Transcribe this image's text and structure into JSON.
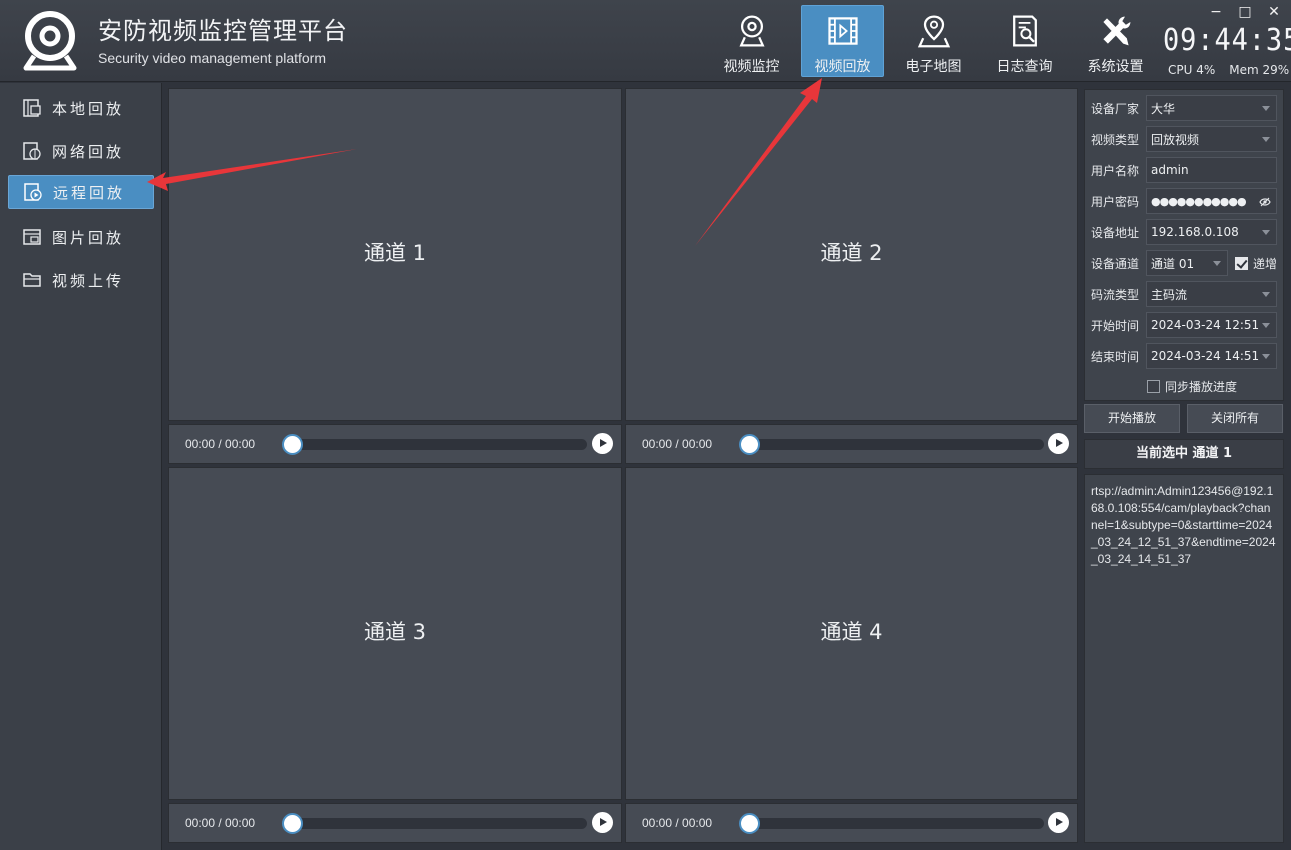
{
  "app": {
    "title": "安防视频监控管理平台",
    "subtitle": "Security video management platform"
  },
  "nav": [
    {
      "label": "视频监控",
      "icon": "webcam-icon"
    },
    {
      "label": "视频回放",
      "icon": "film-icon",
      "active": true
    },
    {
      "label": "电子地图",
      "icon": "map-pin-icon"
    },
    {
      "label": "日志查询",
      "icon": "log-search-icon"
    },
    {
      "label": "系统设置",
      "icon": "tools-icon"
    }
  ],
  "clock": "09:44:35",
  "stats": {
    "cpu": "CPU 4%",
    "mem": "Mem 29%"
  },
  "window_controls": {
    "minimize": "−",
    "maximize": "□",
    "close": "✕"
  },
  "sidebar": [
    {
      "label": "本地回放",
      "icon": "local-playback-icon"
    },
    {
      "label": "网络回放",
      "icon": "network-playback-icon"
    },
    {
      "label": "远程回放",
      "icon": "remote-playback-icon",
      "active": true
    },
    {
      "label": "图片回放",
      "icon": "image-playback-icon"
    },
    {
      "label": "视频上传",
      "icon": "folder-upload-icon"
    }
  ],
  "channels": [
    {
      "label": "通道 1",
      "time": "00:00  /  00:00",
      "progress": 0
    },
    {
      "label": "通道 2",
      "time": "00:00  /  00:00",
      "progress": 0
    },
    {
      "label": "通道 3",
      "time": "00:00  /  00:00",
      "progress": 0
    },
    {
      "label": "通道 4",
      "time": "00:00  /  00:00",
      "progress": 0
    }
  ],
  "form": {
    "vendor_label": "设备厂家",
    "vendor": "大华",
    "video_type_label": "视频类型",
    "video_type": "回放视频",
    "username_label": "用户名称",
    "username": "admin",
    "password_label": "用户密码",
    "password": "●●●●●●●●●●●",
    "address_label": "设备地址",
    "address": "192.168.0.108",
    "channel_label": "设备通道",
    "channel": "通道 01",
    "increment_label": "递增",
    "increment_checked": true,
    "stream_label": "码流类型",
    "stream": "主码流",
    "start_label": "开始时间",
    "start": "2024-03-24 12:51",
    "end_label": "结束时间",
    "end": "2024-03-24 14:51",
    "sync_label": "同步播放进度",
    "sync_checked": false
  },
  "buttons": {
    "start": "开始播放",
    "close_all": "关闭所有"
  },
  "current_selection": "当前选中 通道 1",
  "rtsp_url": "rtsp://admin:Admin123456@192.168.0.108:554/cam/playback?channel=1&subtype=0&starttime=2024_03_24_12_51_37&endtime=2024_03_24_14_51_37",
  "colors": {
    "accent": "#4a8ec2",
    "annotation_arrow": "#e8363a",
    "background": "#2f333b",
    "panel": "#464b54"
  }
}
